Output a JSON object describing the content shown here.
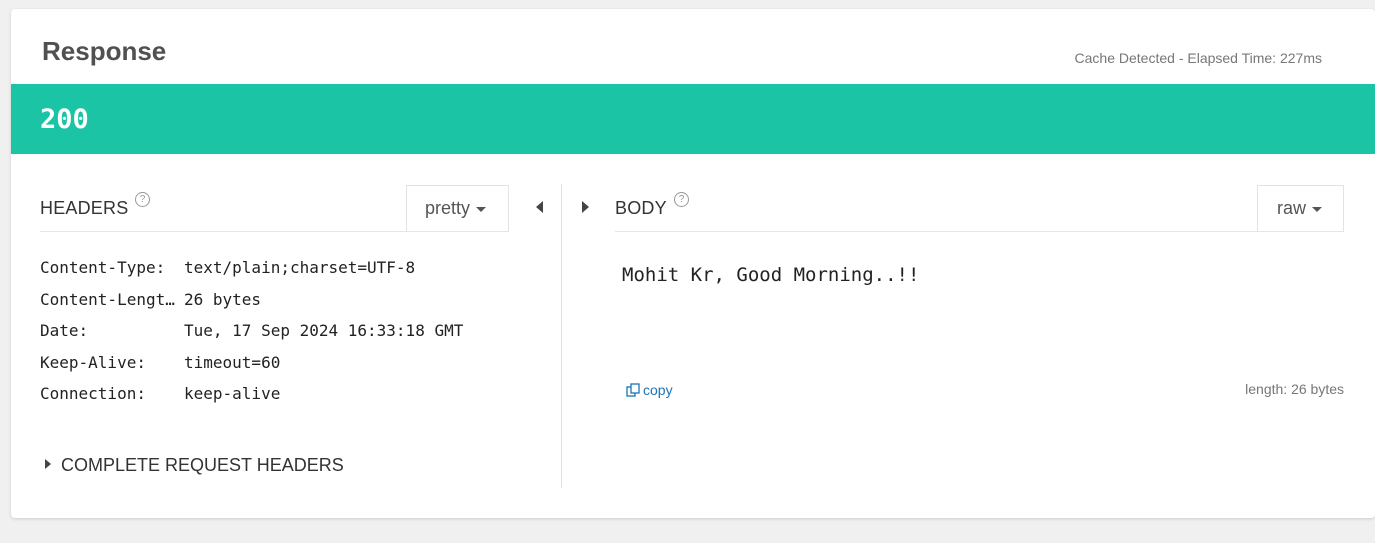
{
  "response": {
    "title": "Response",
    "elapsed": "Cache Detected - Elapsed Time: 227ms",
    "status_code": "200",
    "status_color": "#1bc4a5"
  },
  "headers_panel": {
    "label": "HEADERS",
    "help_icon": "question-circle-icon",
    "format": "pretty",
    "rows": [
      {
        "key": "Content-Type:",
        "value": "text/plain;charset=UTF-8"
      },
      {
        "key": "Content-Length:",
        "value": "26 bytes"
      },
      {
        "key": "Date:",
        "value": "Tue, 17 Sep 2024 16:33:18 GMT"
      },
      {
        "key": "Keep-Alive:",
        "value": "timeout=60"
      },
      {
        "key": "Connection:",
        "value": "keep-alive"
      }
    ],
    "complete_request_headers": "COMPLETE REQUEST HEADERS"
  },
  "body_panel": {
    "label": "BODY",
    "help_icon": "question-circle-icon",
    "format": "raw",
    "content": "Mohit Kr, Good Morning..!!",
    "copy_label": "copy",
    "length": "length: 26 bytes"
  }
}
